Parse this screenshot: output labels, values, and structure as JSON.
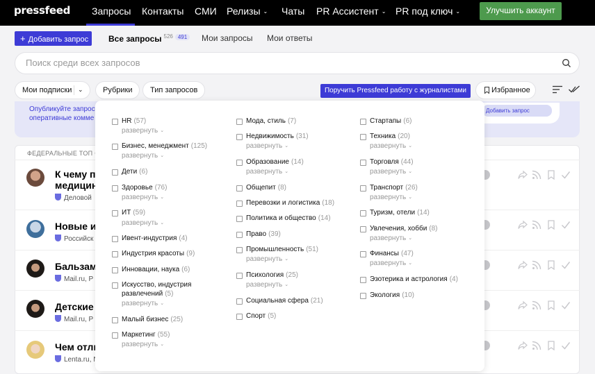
{
  "header": {
    "logo": "pressfeed",
    "nav": [
      {
        "label": "Запросы",
        "active": true
      },
      {
        "label": "Контакты"
      },
      {
        "label": "СМИ"
      },
      {
        "label": "Релизы",
        "dropdown": true
      },
      {
        "label": "Чаты"
      },
      {
        "label": "PR Ассистент",
        "dropdown": true
      },
      {
        "label": "PR под ключ",
        "dropdown": true
      }
    ],
    "upgrade_label": "Улучшить аккаунт",
    "chevron": "⌄"
  },
  "tabs": {
    "add_label": "Добавить запрос",
    "all_label": "Все запросы",
    "all_count": "526",
    "all_new": "491",
    "mine_label": "Мои запросы",
    "answers_label": "Мои ответы"
  },
  "search": {
    "placeholder": "Поиск среди всех запросов"
  },
  "filters": {
    "subscriptions": "Мои подписки",
    "rubrics": "Рубрики",
    "types": "Тип запросов",
    "assign": "Поручить Pressfeed работу с журналистами",
    "favorites": "Избранное"
  },
  "banner": {
    "text": "Опубликуйте запрос оперативные комме",
    "button": "Добавить запрос"
  },
  "list": {
    "header": "ФЕДЕРАЛЬНЫЕ ТОП СМИ",
    "rows": [
      {
        "title": "К чему пр",
        "title2": "медицин",
        "source": "Деловой"
      },
      {
        "title": "Новые ин",
        "source": "Российск"
      },
      {
        "title": "Бальзамы",
        "source": "Mail.ru, Р"
      },
      {
        "title": "Детские с",
        "source": "Mail.ru, Р"
      },
      {
        "title": "Чем отлич",
        "source": "Lenta.ru, N"
      }
    ]
  },
  "dropdown": {
    "expand_label": "развернуть",
    "columns": [
      [
        {
          "name": "HR",
          "count": "(57)",
          "expand": true
        },
        {
          "name": "Бизнес, менеджмент",
          "count": "(125)",
          "expand": true
        },
        {
          "name": "Дети",
          "count": "(6)"
        },
        {
          "name": "Здоровье",
          "count": "(76)",
          "expand": true
        },
        {
          "name": "ИТ",
          "count": "(59)",
          "expand": true
        },
        {
          "name": "Ивент-индустрия",
          "count": "(4)"
        },
        {
          "name": "Индустрия красоты",
          "count": "(9)"
        },
        {
          "name": "Инновации, наука",
          "count": "(6)"
        },
        {
          "name": "Искусство, индустрия",
          "name2": "развлечений",
          "count": "(5)",
          "expand": true
        },
        {
          "name": "Малый бизнес",
          "count": "(25)"
        },
        {
          "name": "Маркетинг",
          "count": "(55)",
          "expand": true
        }
      ],
      [
        {
          "name": "Мода, стиль",
          "count": "(7)"
        },
        {
          "name": "Недвижимость",
          "count": "(31)",
          "expand": true
        },
        {
          "name": "Образование",
          "count": "(14)",
          "expand": true
        },
        {
          "name": "Общепит",
          "count": "(8)"
        },
        {
          "name": "Перевозки и логистика",
          "count": "(18)"
        },
        {
          "name": "Политика и общество",
          "count": "(14)"
        },
        {
          "name": "Право",
          "count": "(39)"
        },
        {
          "name": "Промышленность",
          "count": "(51)",
          "expand": true
        },
        {
          "name": "Психология",
          "count": "(25)",
          "expand": true
        },
        {
          "name": "Социальная сфера",
          "count": "(21)"
        },
        {
          "name": "Спорт",
          "count": "(5)"
        }
      ],
      [
        {
          "name": "Стартапы",
          "count": "(6)"
        },
        {
          "name": "Техника",
          "count": "(20)",
          "expand": true
        },
        {
          "name": "Торговля",
          "count": "(44)",
          "expand": true
        },
        {
          "name": "Транспорт",
          "count": "(26)",
          "expand": true
        },
        {
          "name": "Туризм, отели",
          "count": "(14)"
        },
        {
          "name": "Увлечения, хобби",
          "count": "(8)",
          "expand": true
        },
        {
          "name": "Финансы",
          "count": "(47)",
          "expand": true
        },
        {
          "name": "Эзотерика и астрология",
          "count": "(4)"
        },
        {
          "name": "Экология",
          "count": "(10)"
        }
      ]
    ]
  },
  "colors": {
    "accent": "#3d3bd6",
    "success": "#4d9a4d",
    "topbar": "#000000"
  }
}
